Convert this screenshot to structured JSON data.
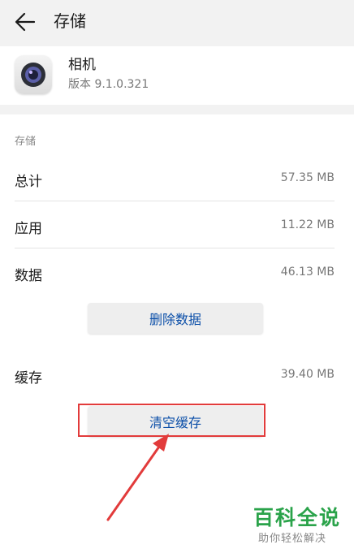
{
  "header": {
    "title": "存储"
  },
  "app": {
    "name": "相机",
    "version": "版本 9.1.0.321"
  },
  "storage": {
    "section_label": "存储",
    "rows": [
      {
        "label": "总计",
        "value": "57.35 MB"
      },
      {
        "label": "应用",
        "value": "11.22 MB"
      },
      {
        "label": "数据",
        "value": "46.13 MB"
      }
    ],
    "delete_data_button": "删除数据",
    "cache": {
      "label": "缓存",
      "value": "39.40 MB"
    },
    "clear_cache_button": "清空缓存"
  },
  "watermark": {
    "main": "百科全说",
    "sub": "助你轻松解决"
  },
  "colors": {
    "accent": "#0a4ea8",
    "highlight": "#e23b3b",
    "watermark": "#2aa34a"
  },
  "icons": {
    "back": "back-arrow-icon",
    "app": "camera-app-icon"
  }
}
